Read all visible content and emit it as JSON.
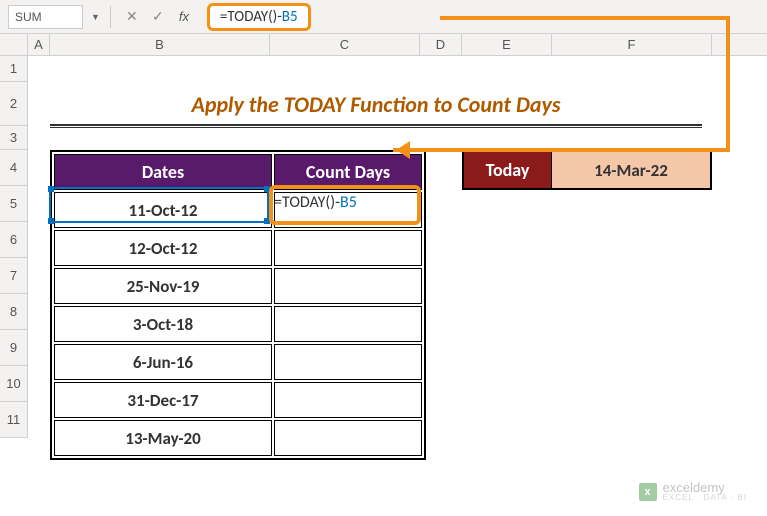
{
  "nameBox": "SUM",
  "formulaBar": "=TODAY()-B5",
  "formulaParts": {
    "prefix": "=TODAY()-",
    "ref": "B5"
  },
  "columns": [
    "A",
    "B",
    "C",
    "D",
    "E",
    "F"
  ],
  "rows": [
    "1",
    "2",
    "3",
    "4",
    "5",
    "6",
    "7",
    "8",
    "9",
    "10",
    "11"
  ],
  "title": "Apply the TODAY Function to Count Days",
  "headers": {
    "dates": "Dates",
    "count": "Count Days"
  },
  "dates": [
    "11-Oct-12",
    "12-Oct-12",
    "25-Nov-19",
    "3-Oct-18",
    "6-Jun-16",
    "31-Dec-17",
    "13-May-20"
  ],
  "today": {
    "label": "Today",
    "value": "14-Mar-22"
  },
  "cellFormula": {
    "eq": "=",
    "fn": "TODAY()-",
    "ref": "B5"
  },
  "watermark": {
    "name": "exceldemy",
    "tag": "EXCEL · DATA · BI",
    "icon": "x"
  },
  "chart_data": {
    "type": "table",
    "title": "Apply the TODAY Function to Count Days",
    "columns": [
      "Dates",
      "Count Days"
    ],
    "rows": [
      [
        "11-Oct-12",
        "=TODAY()-B5"
      ],
      [
        "12-Oct-12",
        ""
      ],
      [
        "25-Nov-19",
        ""
      ],
      [
        "3-Oct-18",
        ""
      ],
      [
        "6-Jun-16",
        ""
      ],
      [
        "31-Dec-17",
        ""
      ],
      [
        "13-May-20",
        ""
      ]
    ],
    "aux": {
      "Today": "14-Mar-22"
    }
  }
}
